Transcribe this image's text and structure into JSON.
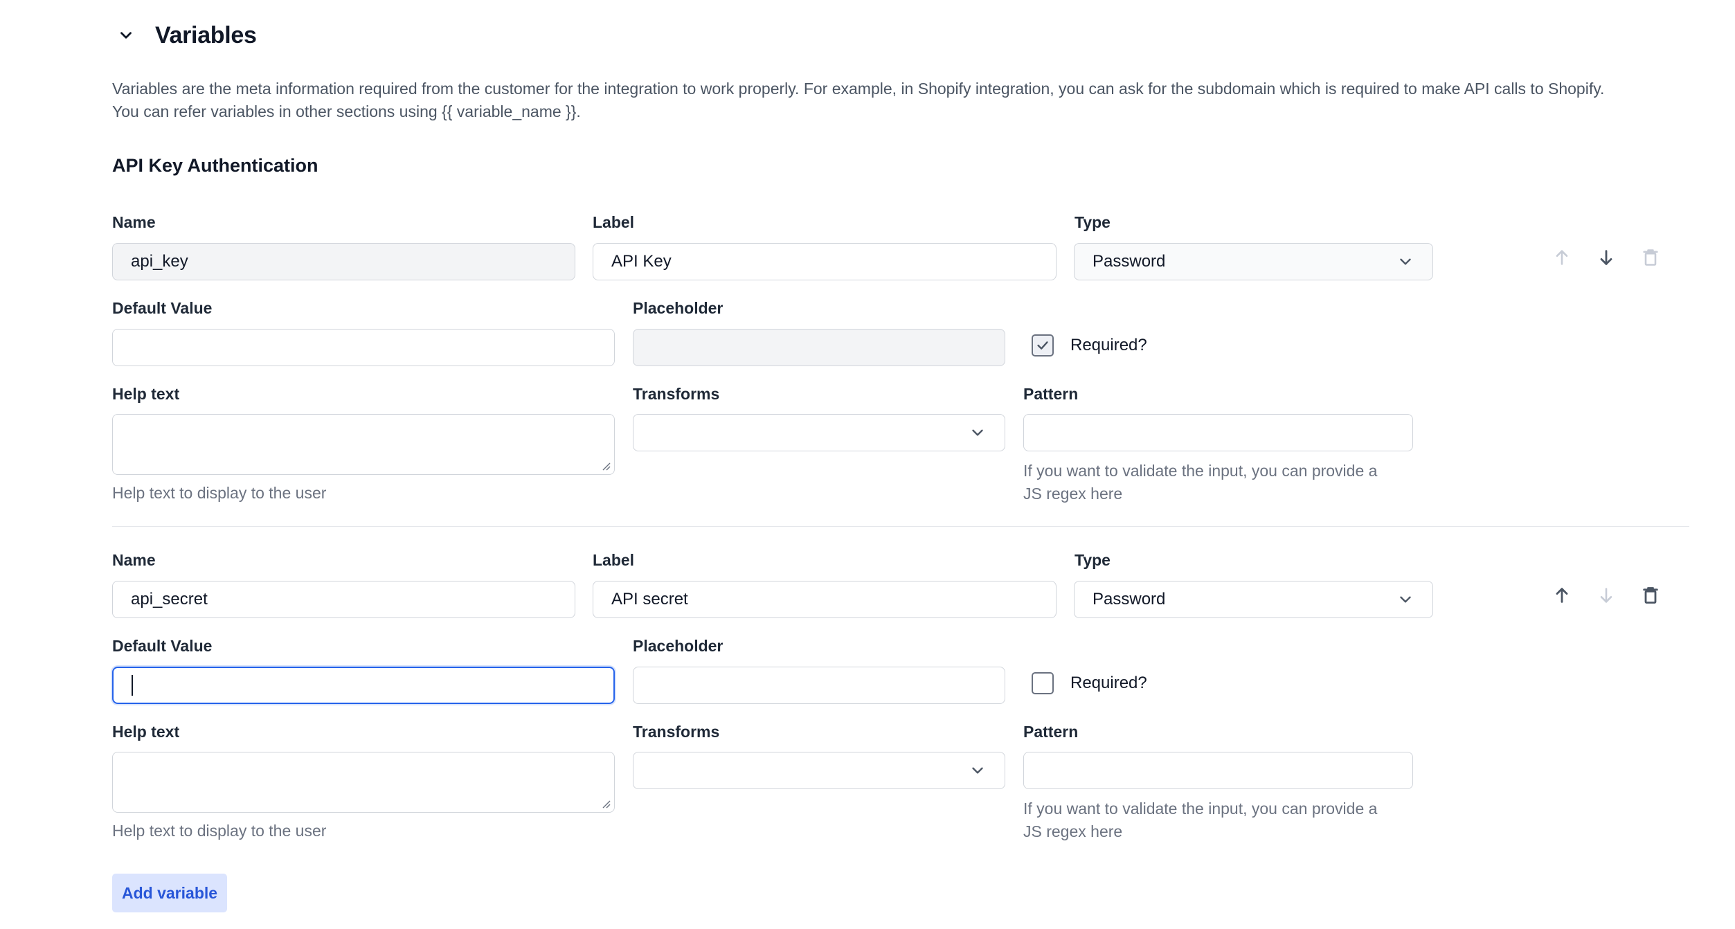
{
  "section": {
    "title": "Variables",
    "description_line1": "Variables are the meta information required from the customer for the integration to work properly. For example, in Shopify integration, you can ask for the subdomain which is required to make API calls to Shopify.",
    "description_line2": "You can refer variables in other sections using {{ variable_name }}."
  },
  "group_title": "API Key Authentication",
  "labels": {
    "name": "Name",
    "label": "Label",
    "type": "Type",
    "default_value": "Default Value",
    "placeholder": "Placeholder",
    "required": "Required?",
    "help_text": "Help text",
    "transforms": "Transforms",
    "pattern": "Pattern",
    "help_hint": "Help text to display to the user",
    "pattern_hint_line1": "If you want to validate the input, you can provide a",
    "pattern_hint_line2": "JS regex here"
  },
  "variables": [
    {
      "name": "api_key",
      "label": "API Key",
      "type": "Password",
      "default_value": "",
      "placeholder": "",
      "required": true,
      "help_text": "",
      "transforms": "",
      "pattern": ""
    },
    {
      "name": "api_secret",
      "label": "API secret",
      "type": "Password",
      "default_value": "",
      "placeholder": "",
      "required": false,
      "help_text": "",
      "transforms": "",
      "pattern": ""
    }
  ],
  "add_button_label": "Add variable",
  "colors": {
    "accent": "#2563eb",
    "add_button_bg": "#dbe4fe",
    "add_button_text": "#2856d8",
    "text_muted": "#6b7280"
  }
}
